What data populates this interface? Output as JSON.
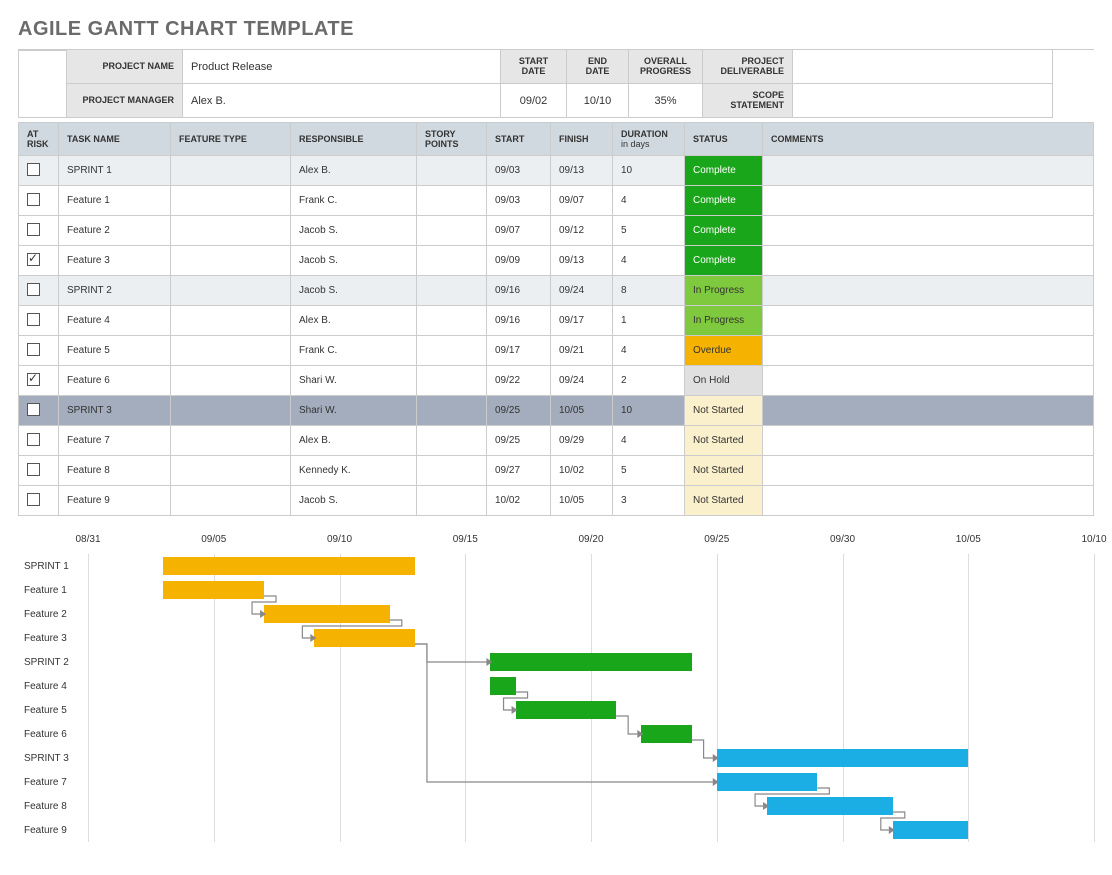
{
  "title": "AGILE GANTT CHART TEMPLATE",
  "info": {
    "project_name_label": "PROJECT NAME",
    "project_name": "Product Release",
    "project_manager_label": "PROJECT MANAGER",
    "project_manager": "Alex B.",
    "start_date_label": "START DATE",
    "start_date": "09/02",
    "end_date_label": "END DATE",
    "end_date": "10/10",
    "overall_progress_label": "OVERALL PROGRESS",
    "overall_progress": "35%",
    "project_deliverable_label": "PROJECT DELIVERABLE",
    "project_deliverable": "",
    "scope_statement_label": "SCOPE STATEMENT",
    "scope_statement": ""
  },
  "columns": {
    "at_risk": "AT RISK",
    "task_name": "TASK NAME",
    "feature_type": "FEATURE TYPE",
    "responsible": "RESPONSIBLE",
    "story_points": "STORY POINTS",
    "start": "START",
    "finish": "FINISH",
    "duration": "DURATION",
    "duration_sub": "in days",
    "status": "STATUS",
    "comments": "COMMENTS"
  },
  "rows": [
    {
      "risk": false,
      "task": "SPRINT 1",
      "feat": "",
      "resp": "Alex B.",
      "sp": "",
      "start": "09/03",
      "finish": "09/13",
      "dur": "10",
      "status": "Complete",
      "status_class": "st-complete",
      "row_class": "sprint"
    },
    {
      "risk": false,
      "task": "Feature 1",
      "feat": "",
      "resp": "Frank C.",
      "sp": "",
      "start": "09/03",
      "finish": "09/07",
      "dur": "4",
      "status": "Complete",
      "status_class": "st-complete",
      "row_class": ""
    },
    {
      "risk": false,
      "task": "Feature 2",
      "feat": "",
      "resp": "Jacob S.",
      "sp": "",
      "start": "09/07",
      "finish": "09/12",
      "dur": "5",
      "status": "Complete",
      "status_class": "st-complete",
      "row_class": ""
    },
    {
      "risk": true,
      "task": "Feature 3",
      "feat": "",
      "resp": "Jacob S.",
      "sp": "",
      "start": "09/09",
      "finish": "09/13",
      "dur": "4",
      "status": "Complete",
      "status_class": "st-complete",
      "row_class": ""
    },
    {
      "risk": false,
      "task": "SPRINT 2",
      "feat": "",
      "resp": "Jacob S.",
      "sp": "",
      "start": "09/16",
      "finish": "09/24",
      "dur": "8",
      "status": "In Progress",
      "status_class": "st-inprogress",
      "row_class": "sprint"
    },
    {
      "risk": false,
      "task": "Feature 4",
      "feat": "",
      "resp": "Alex B.",
      "sp": "",
      "start": "09/16",
      "finish": "09/17",
      "dur": "1",
      "status": "In Progress",
      "status_class": "st-inprogress",
      "row_class": ""
    },
    {
      "risk": false,
      "task": "Feature 5",
      "feat": "",
      "resp": "Frank C.",
      "sp": "",
      "start": "09/17",
      "finish": "09/21",
      "dur": "4",
      "status": "Overdue",
      "status_class": "st-overdue",
      "row_class": ""
    },
    {
      "risk": true,
      "task": "Feature 6",
      "feat": "",
      "resp": "Shari W.",
      "sp": "",
      "start": "09/22",
      "finish": "09/24",
      "dur": "2",
      "status": "On Hold",
      "status_class": "st-onhold",
      "row_class": ""
    },
    {
      "risk": false,
      "task": "SPRINT 3",
      "feat": "",
      "resp": "Shari W.",
      "sp": "",
      "start": "09/25",
      "finish": "10/05",
      "dur": "10",
      "status": "Not Started",
      "status_class": "st-notstarted",
      "row_class": "sprint-sel"
    },
    {
      "risk": false,
      "task": "Feature 7",
      "feat": "",
      "resp": "Alex B.",
      "sp": "",
      "start": "09/25",
      "finish": "09/29",
      "dur": "4",
      "status": "Not Started",
      "status_class": "st-notstarted",
      "row_class": ""
    },
    {
      "risk": false,
      "task": "Feature 8",
      "feat": "",
      "resp": "Kennedy K.",
      "sp": "",
      "start": "09/27",
      "finish": "10/02",
      "dur": "5",
      "status": "Not Started",
      "status_class": "st-notstarted",
      "row_class": ""
    },
    {
      "risk": false,
      "task": "Feature 9",
      "feat": "",
      "resp": "Jacob S.",
      "sp": "",
      "start": "10/02",
      "finish": "10/05",
      "dur": "3",
      "status": "Not Started",
      "status_class": "st-notstarted",
      "row_class": ""
    }
  ],
  "chart_data": {
    "type": "bar",
    "title": "",
    "xlabel": "",
    "ylabel": "",
    "x_start": "08/31",
    "x_end": "10/10",
    "ticks": [
      "08/31",
      "09/05",
      "09/10",
      "09/15",
      "09/20",
      "09/25",
      "09/30",
      "10/05",
      "10/10"
    ],
    "series": [
      {
        "name": "SPRINT 1",
        "start": "09/03",
        "end": "09/13",
        "color": "orange"
      },
      {
        "name": "Feature 1",
        "start": "09/03",
        "end": "09/07",
        "color": "orange"
      },
      {
        "name": "Feature 2",
        "start": "09/07",
        "end": "09/12",
        "color": "orange"
      },
      {
        "name": "Feature 3",
        "start": "09/09",
        "end": "09/13",
        "color": "orange"
      },
      {
        "name": "SPRINT 2",
        "start": "09/16",
        "end": "09/24",
        "color": "green"
      },
      {
        "name": "Feature 4",
        "start": "09/16",
        "end": "09/17",
        "color": "green"
      },
      {
        "name": "Feature 5",
        "start": "09/17",
        "end": "09/21",
        "color": "green"
      },
      {
        "name": "Feature 6",
        "start": "09/22",
        "end": "09/24",
        "color": "green"
      },
      {
        "name": "SPRINT 3",
        "start": "09/25",
        "end": "10/05",
        "color": "blue"
      },
      {
        "name": "Feature 7",
        "start": "09/25",
        "end": "09/29",
        "color": "blue"
      },
      {
        "name": "Feature 8",
        "start": "09/27",
        "end": "10/02",
        "color": "blue"
      },
      {
        "name": "Feature 9",
        "start": "10/02",
        "end": "10/05",
        "color": "blue"
      }
    ],
    "dependencies": [
      {
        "from": "Feature 1",
        "to": "Feature 2"
      },
      {
        "from": "Feature 2",
        "to": "Feature 3"
      },
      {
        "from": "Feature 3",
        "to": "SPRINT 2"
      },
      {
        "from": "Feature 3",
        "to": "Feature 7"
      },
      {
        "from": "Feature 4",
        "to": "Feature 5"
      },
      {
        "from": "Feature 5",
        "to": "Feature 6"
      },
      {
        "from": "Feature 6",
        "to": "SPRINT 3"
      },
      {
        "from": "Feature 7",
        "to": "Feature 8"
      },
      {
        "from": "Feature 8",
        "to": "Feature 9"
      }
    ]
  }
}
